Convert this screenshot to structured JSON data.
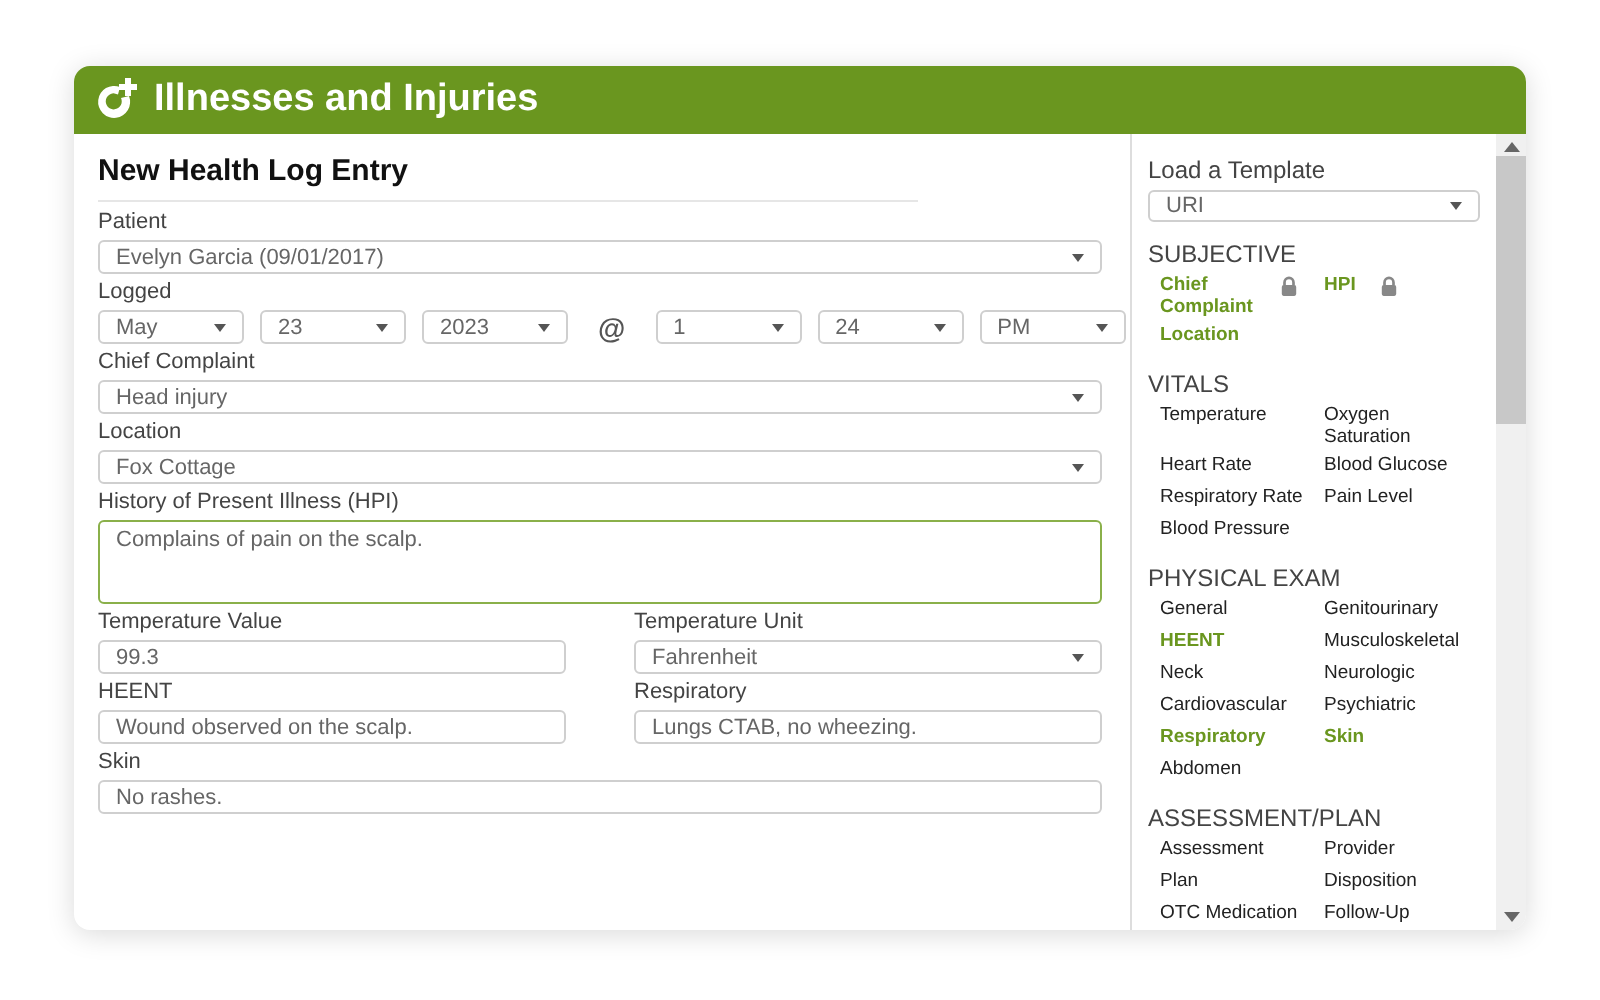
{
  "header": {
    "title": "Illnesses and Injuries"
  },
  "form": {
    "title": "New Health Log Entry",
    "rows": [
      {
        "fields": [
          {
            "kind": "select",
            "label": "Patient",
            "value": "Evelyn Garcia (09/01/2017)"
          }
        ]
      },
      {
        "fields": [
          {
            "kind": "datetime",
            "label": "Logged",
            "separator": "@",
            "parts": [
              "May",
              "23",
              "2023",
              "1",
              "24",
              "PM"
            ]
          }
        ]
      },
      {
        "fields": [
          {
            "kind": "select",
            "label": "Chief Complaint",
            "value": "Head injury"
          }
        ]
      },
      {
        "fields": [
          {
            "kind": "select",
            "label": "Location",
            "value": "Fox Cottage"
          }
        ]
      },
      {
        "fields": [
          {
            "kind": "textarea",
            "label": "History of Present Illness (HPI)",
            "value": "Complains of pain on the scalp."
          }
        ]
      },
      {
        "fields": [
          {
            "kind": "text",
            "label": "Temperature Value",
            "value": "99.3"
          },
          {
            "kind": "select",
            "label": "Temperature Unit",
            "value": "Fahrenheit"
          }
        ]
      },
      {
        "fields": [
          {
            "kind": "text",
            "label": "HEENT",
            "value": "Wound observed on the scalp."
          },
          {
            "kind": "text",
            "label": "Respiratory",
            "value": "Lungs CTAB, no wheezing."
          }
        ]
      },
      {
        "fields": [
          {
            "kind": "text",
            "label": "Skin",
            "value": "No rashes."
          }
        ]
      }
    ]
  },
  "template": {
    "label": "Load a Template",
    "value": "URI",
    "sections": [
      {
        "title": "SUBJECTIVE",
        "items": [
          {
            "label": "Chief Complaint",
            "selected": true,
            "locked": true
          },
          {
            "label": "HPI",
            "selected": true,
            "locked": true
          },
          {
            "label": "Location",
            "selected": true,
            "locked": false
          }
        ]
      },
      {
        "title": "VITALS",
        "items": [
          {
            "label": "Temperature",
            "selected": false,
            "locked": false
          },
          {
            "label": "Oxygen Saturation",
            "selected": false,
            "locked": false
          },
          {
            "label": "Heart Rate",
            "selected": false,
            "locked": false
          },
          {
            "label": "Blood Glucose",
            "selected": false,
            "locked": false
          },
          {
            "label": "Respiratory Rate",
            "selected": false,
            "locked": false
          },
          {
            "label": "Pain Level",
            "selected": false,
            "locked": false
          },
          {
            "label": "Blood Pressure",
            "selected": false,
            "locked": false
          }
        ]
      },
      {
        "title": "PHYSICAL EXAM",
        "items": [
          {
            "label": "General",
            "selected": false,
            "locked": false
          },
          {
            "label": "Genitourinary",
            "selected": false,
            "locked": false
          },
          {
            "label": "HEENT",
            "selected": true,
            "locked": false
          },
          {
            "label": "Musculoskeletal",
            "selected": false,
            "locked": false
          },
          {
            "label": "Neck",
            "selected": false,
            "locked": false
          },
          {
            "label": "Neurologic",
            "selected": false,
            "locked": false
          },
          {
            "label": "Cardiovascular",
            "selected": false,
            "locked": false
          },
          {
            "label": "Psychiatric",
            "selected": false,
            "locked": false
          },
          {
            "label": "Respiratory",
            "selected": true,
            "locked": false
          },
          {
            "label": "Skin",
            "selected": true,
            "locked": false
          },
          {
            "label": "Abdomen",
            "selected": false,
            "locked": false
          }
        ]
      },
      {
        "title": "ASSESSMENT/PLAN",
        "items": [
          {
            "label": "Assessment",
            "selected": false,
            "locked": false
          },
          {
            "label": "Provider",
            "selected": false,
            "locked": false
          },
          {
            "label": "Plan",
            "selected": false,
            "locked": false
          },
          {
            "label": "Disposition",
            "selected": false,
            "locked": false
          },
          {
            "label": "OTC Medication",
            "selected": false,
            "locked": false
          },
          {
            "label": "Follow-Up",
            "selected": false,
            "locked": false
          }
        ]
      }
    ]
  }
}
